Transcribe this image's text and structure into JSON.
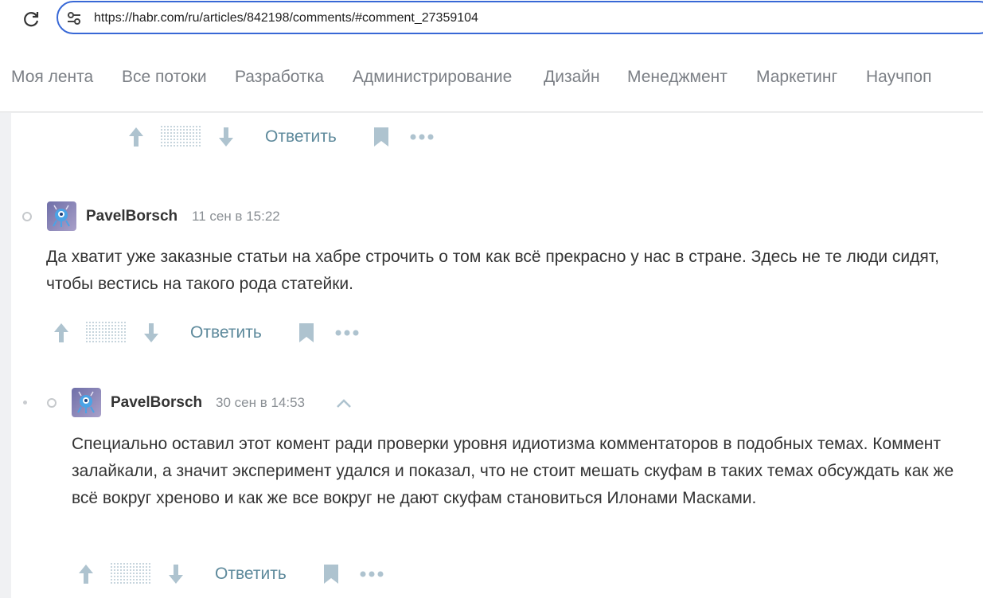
{
  "browser": {
    "url": "https://habr.com/ru/articles/842198/comments/#comment_27359104"
  },
  "nav": {
    "items": [
      "Моя лента",
      "Все потоки",
      "Разработка",
      "Администрирование",
      "Дизайн",
      "Менеджмент",
      "Маркетинг",
      "Научпоп"
    ]
  },
  "comments": [
    {
      "reply_label": "Ответить"
    },
    {
      "author": "PavelBorsch",
      "time": "11 сен в 15:22",
      "text": "Да хватит уже заказные статьи на хабре строчить о том как всё прекрасно у нас в стране. Здесь не те люди сидят, чтобы вестись на такого рода статейки.",
      "reply_label": "Ответить"
    },
    {
      "author": "PavelBorsch",
      "time": "30 сен в 14:53",
      "text": "Специально оставил этот комент ради проверки уровня идиотизма комментаторов в подобных темах. Коммент залайкали, а значит эксперимент удался и показал, что не стоит мешать скуфам в таких темах обсуждать как же всё вокруг хреново и как же все вокруг не дают скуфам становиться Илонами Масками.",
      "reply_label": "Ответить"
    }
  ],
  "colors": {
    "accent": "#3868d6",
    "reply": "#5e8a9c",
    "icon": "#aec3cf"
  }
}
